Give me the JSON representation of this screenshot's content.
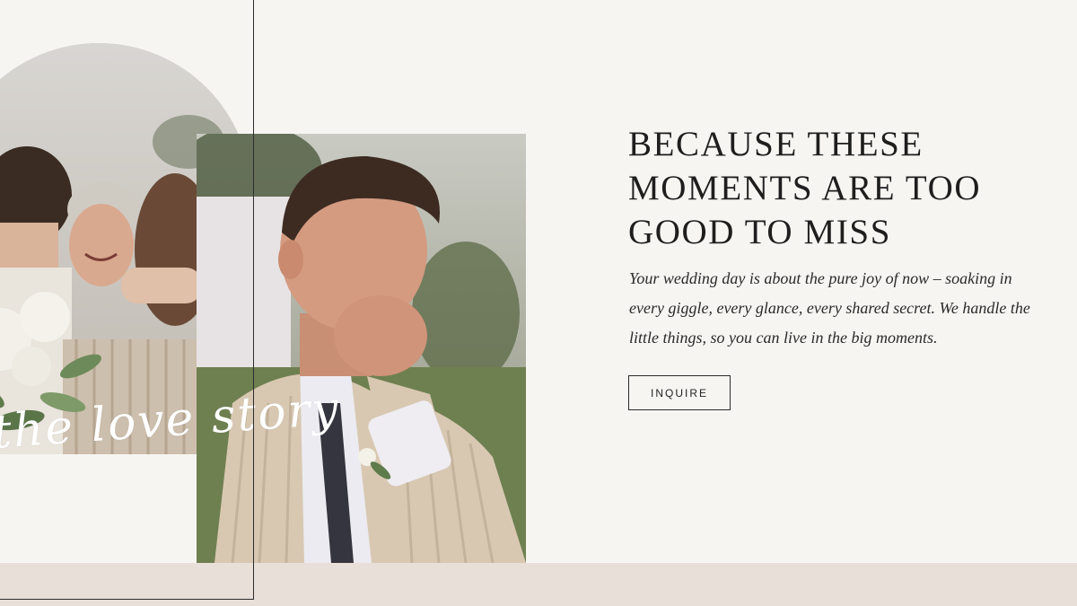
{
  "hero": {
    "script_overlay": "the love story",
    "headline_lines": [
      "BECAUSE THESE",
      "MOMENTS ARE TOO",
      "GOOD TO MISS"
    ],
    "body": "Your wedding day is about the pure joy of now – soaking in every giggle, every glance, every shared secret. We handle the little things, so you can live in the big moments.",
    "cta_label": "INQUIRE"
  },
  "colors": {
    "background": "#f7f5f2",
    "bottom_band": "#e8dfd8",
    "text": "#1e1e1e",
    "line": "#2d2d2d"
  },
  "images": {
    "arch_photo": "photo-embrace",
    "square_photo": "photo-groom-laughing"
  }
}
